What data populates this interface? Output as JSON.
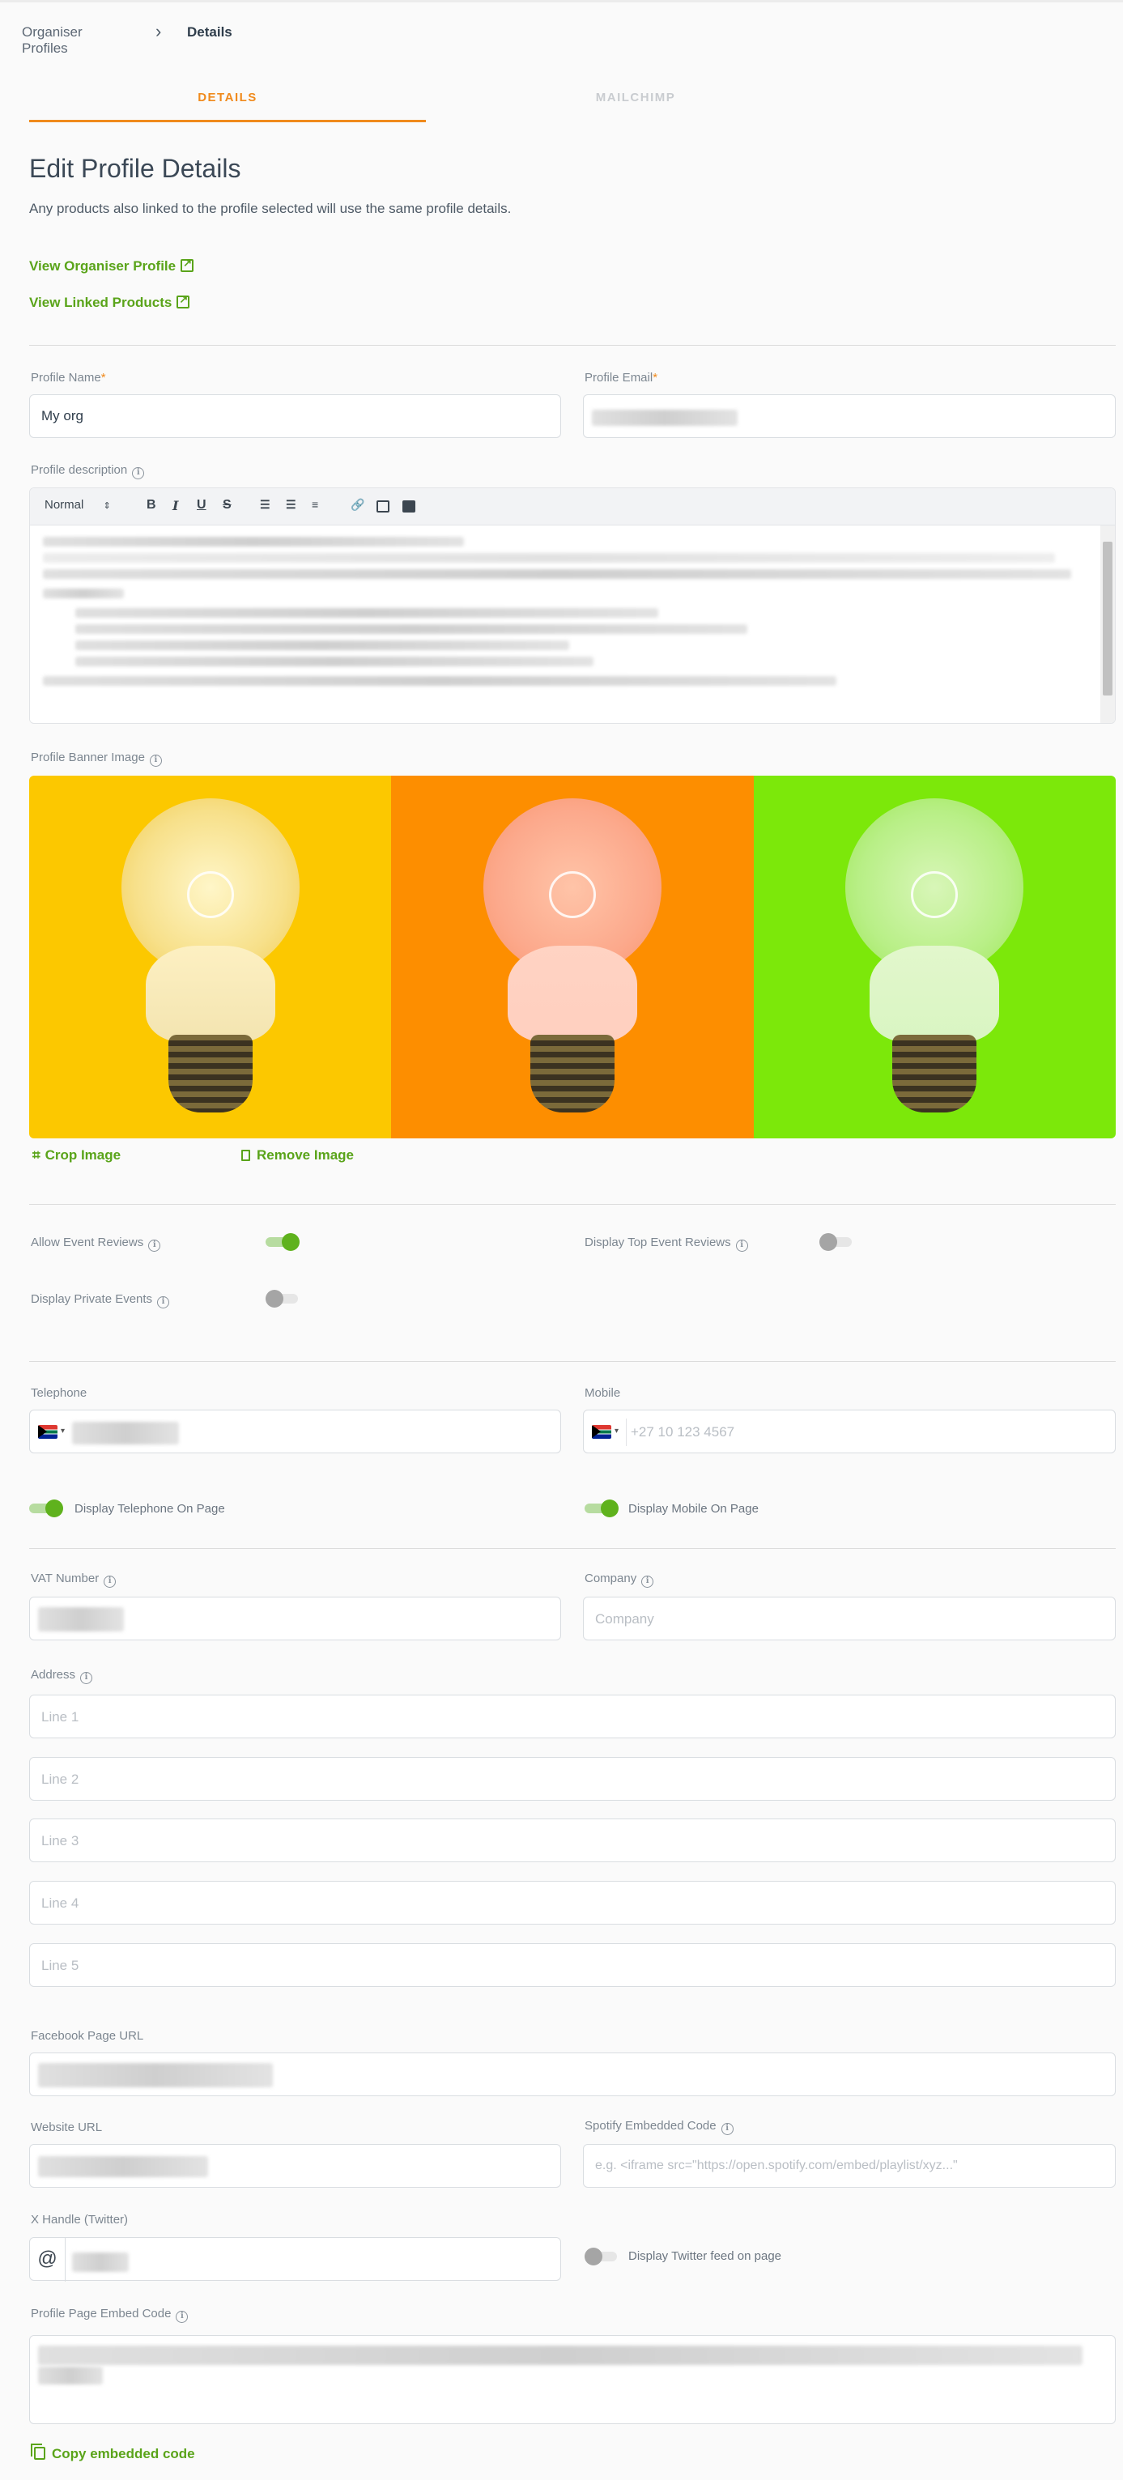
{
  "breadcrumb": {
    "parent": "Organiser Profiles",
    "current": "Details"
  },
  "tabs": [
    {
      "label": "DETAILS",
      "active": true
    },
    {
      "label": "MAILCHIMP",
      "active": false
    }
  ],
  "header": {
    "title": "Edit Profile Details",
    "subtitle": "Any products also linked to the profile selected will use the same profile details."
  },
  "links": {
    "view_profile": "View Organiser Profile",
    "view_products": "View Linked Products"
  },
  "form": {
    "profile_name_label": "Profile Name",
    "profile_name_value": "My org",
    "profile_email_label": "Profile Email",
    "required_mark": "*",
    "description_label": "Profile description",
    "editor_format": "Normal",
    "banner_label": "Profile Banner Image",
    "crop_label": "Crop Image",
    "remove_label": "Remove Image",
    "allow_reviews_label": "Allow Event Reviews",
    "allow_reviews_on": true,
    "top_reviews_label": "Display Top Event Reviews",
    "top_reviews_on": false,
    "private_events_label": "Display Private Events",
    "private_events_on": false,
    "telephone_label": "Telephone",
    "mobile_label": "Mobile",
    "mobile_placeholder": "+27 10 123 4567",
    "display_telephone_label": "Display Telephone On Page",
    "display_telephone_on": true,
    "display_mobile_label": "Display Mobile On Page",
    "display_mobile_on": true,
    "vat_label": "VAT Number",
    "company_label": "Company",
    "company_placeholder": "Company",
    "address_label": "Address",
    "address_lines": [
      "Line 1",
      "Line 2",
      "Line 3",
      "Line 4",
      "Line 5"
    ],
    "facebook_label": "Facebook Page URL",
    "website_label": "Website URL",
    "spotify_label": "Spotify Embedded Code",
    "spotify_placeholder": "e.g. <iframe src=\"https://open.spotify.com/embed/playlist/xyz...\"",
    "twitter_label": "X Handle (Twitter)",
    "twitter_at": "@",
    "twitter_feed_label": "Display Twitter feed on page",
    "twitter_feed_on": false,
    "embed_label": "Profile Page Embed Code",
    "copy_label": "Copy embedded code"
  },
  "icons": {
    "chevron": "chevron-right-icon",
    "external": "external-link-icon",
    "info": "info-icon",
    "crop": "crop-icon",
    "trash": "trash-icon",
    "copy": "copy-icon",
    "flag": "south-africa-flag-icon"
  },
  "colors": {
    "accent_orange": "#f08a1c",
    "accent_green": "#5aa41a",
    "banner_yellow": "#fcc800",
    "banner_orange": "#fd8e00",
    "banner_green": "#7ce80a"
  }
}
